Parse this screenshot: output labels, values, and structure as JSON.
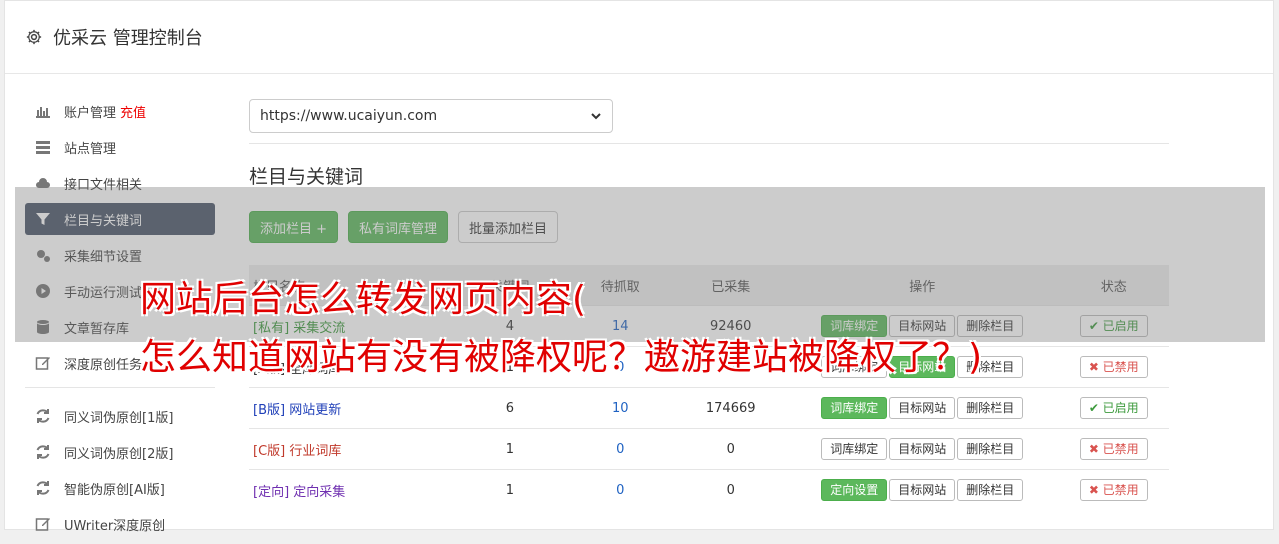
{
  "header": {
    "title": "优采云 管理控制台"
  },
  "sidebar": {
    "items": [
      {
        "label": "账户管理",
        "accent": "充值"
      },
      {
        "label": "站点管理"
      },
      {
        "label": "接口文件相关"
      },
      {
        "label": "栏目与关键词"
      },
      {
        "label": "采集细节设置"
      },
      {
        "label": "手动运行测试"
      },
      {
        "label": "文章暂存库"
      },
      {
        "label": "深度原创任务"
      },
      {
        "label": "同义词伪原创[1版]"
      },
      {
        "label": "同义词伪原创[2版]"
      },
      {
        "label": "智能伪原创[AI版]"
      },
      {
        "label": "UWriter深度原创"
      }
    ]
  },
  "main": {
    "site_select": "https://www.ucaiyun.com",
    "section_title": "栏目与关键词",
    "buttons": {
      "add": "添加栏目 +",
      "private": "私有词库管理",
      "batch": "批量添加栏目"
    },
    "table": {
      "headers": [
        "栏目名称",
        "关键词",
        "待抓取",
        "已采集",
        "操作",
        "状态"
      ],
      "rows": [
        {
          "tag": "[私有]",
          "name": "采集交流",
          "kw": "4",
          "pending": "14",
          "done": "92460",
          "op1": "词库绑定",
          "op2": "目标网站",
          "op3": "删除栏目",
          "state": "✔ 已启用"
        },
        {
          "tag": "[A版]",
          "name": "全库词库",
          "kw": "1",
          "pending": "0",
          "done": "0",
          "op1": "词库绑定",
          "op2": "目标网站",
          "op3": "删除栏目",
          "state": "✖ 已禁用"
        },
        {
          "tag": "[B版]",
          "name": "网站更新",
          "kw": "6",
          "pending": "10",
          "done": "174669",
          "op1": "词库绑定",
          "op2": "目标网站",
          "op3": "删除栏目",
          "state": "✔ 已启用"
        },
        {
          "tag": "[C版]",
          "name": "行业词库",
          "kw": "1",
          "pending": "0",
          "done": "0",
          "op1": "词库绑定",
          "op2": "目标网站",
          "op3": "删除栏目",
          "state": "✖ 已禁用"
        },
        {
          "tag": "[定向]",
          "name": "定向采集",
          "kw": "1",
          "pending": "0",
          "done": "0",
          "op1": "定向设置",
          "op2": "目标网站",
          "op3": "删除栏目",
          "state": "✖ 已禁用"
        }
      ]
    }
  },
  "watermark": {
    "line1": "网站后台怎么转发网页内容(",
    "line2": "怎么知道网站有没有被降权呢？遨游建站被降权了？)"
  },
  "colors": {
    "accent_green": "#5cb85c",
    "active_nav": "#4a5568",
    "watermark_red": "#e00000"
  }
}
